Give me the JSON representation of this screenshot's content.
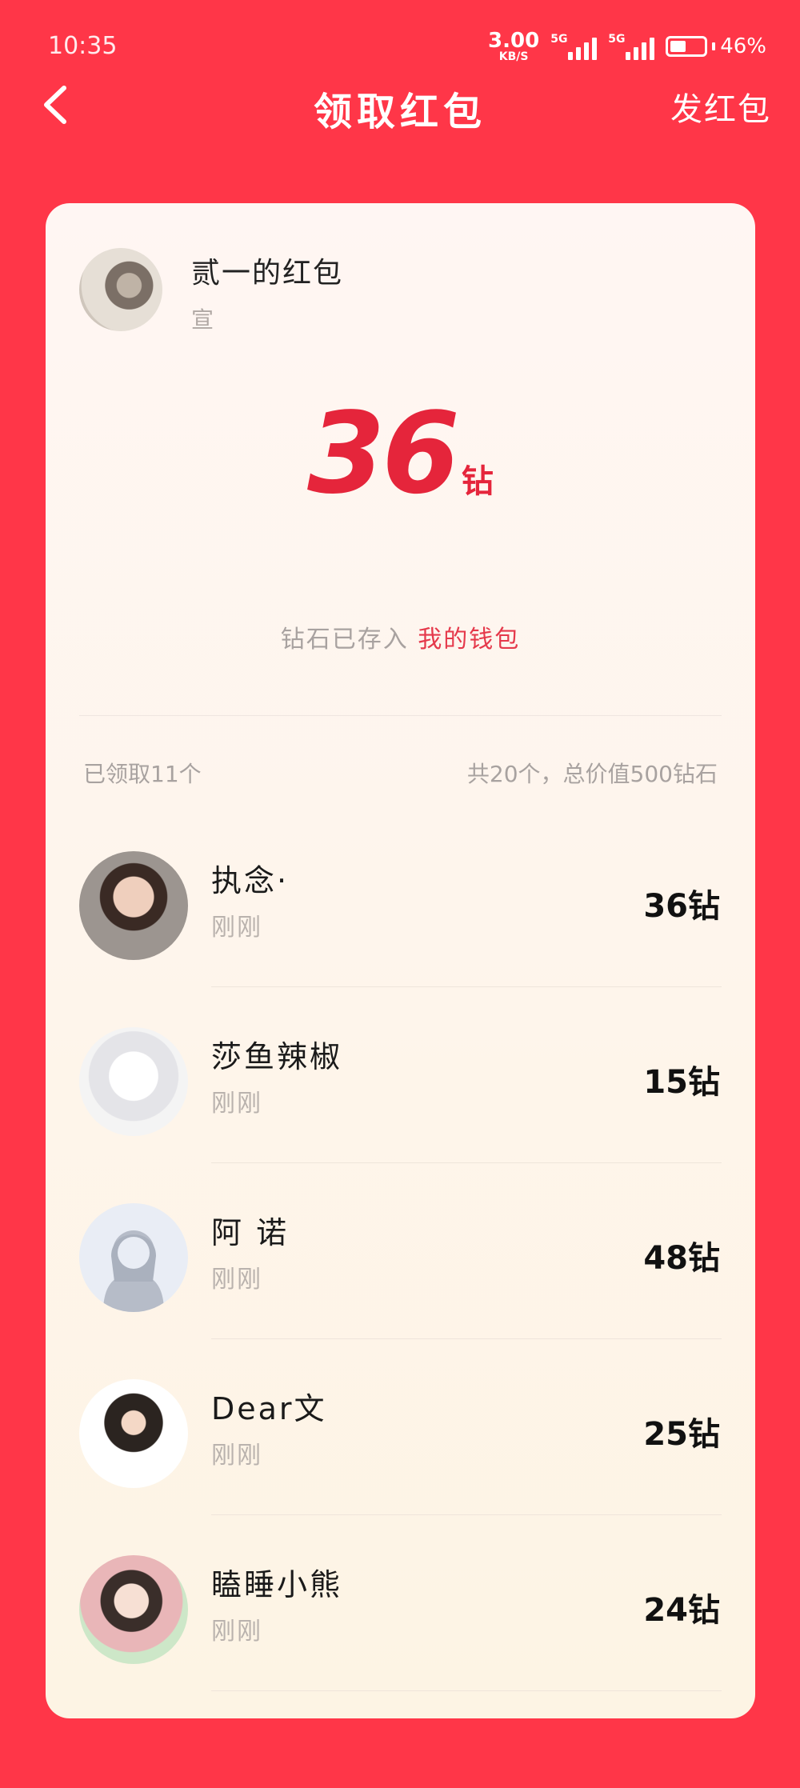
{
  "status_bar": {
    "time": "10:35",
    "net_speed": "3.00",
    "net_speed_unit": "KB/S",
    "signal1_tag": "5G",
    "signal2_tag": "5G",
    "battery_percent": "46%",
    "battery_level": 0.46
  },
  "nav": {
    "back_icon": "chevron-left-icon",
    "title": "领取红包",
    "action_label": "发红包"
  },
  "sender": {
    "name": "贰一的红包",
    "subtitle": "宣"
  },
  "amount": {
    "value": "36",
    "unit": "钻"
  },
  "wallet_note": {
    "prefix": "钻石已存入",
    "link_label": "我的钱包"
  },
  "summary": {
    "received_text": "已领取11个",
    "total_text": "共20个，总价值500钻石"
  },
  "records": [
    {
      "name": "执念·",
      "time": "刚刚",
      "amount": "36钻"
    },
    {
      "name": "莎鱼辣椒",
      "time": "刚刚",
      "amount": "15钻"
    },
    {
      "name": "阿 诺",
      "time": "刚刚",
      "amount": "48钻"
    },
    {
      "name": "Dear文",
      "time": "刚刚",
      "amount": "25钻"
    },
    {
      "name": "瞌睡小熊",
      "time": "刚刚",
      "amount": "24钻"
    }
  ],
  "colors": {
    "background": "#ff3648",
    "accent": "#e5253b",
    "card": "#fdf5ee"
  }
}
